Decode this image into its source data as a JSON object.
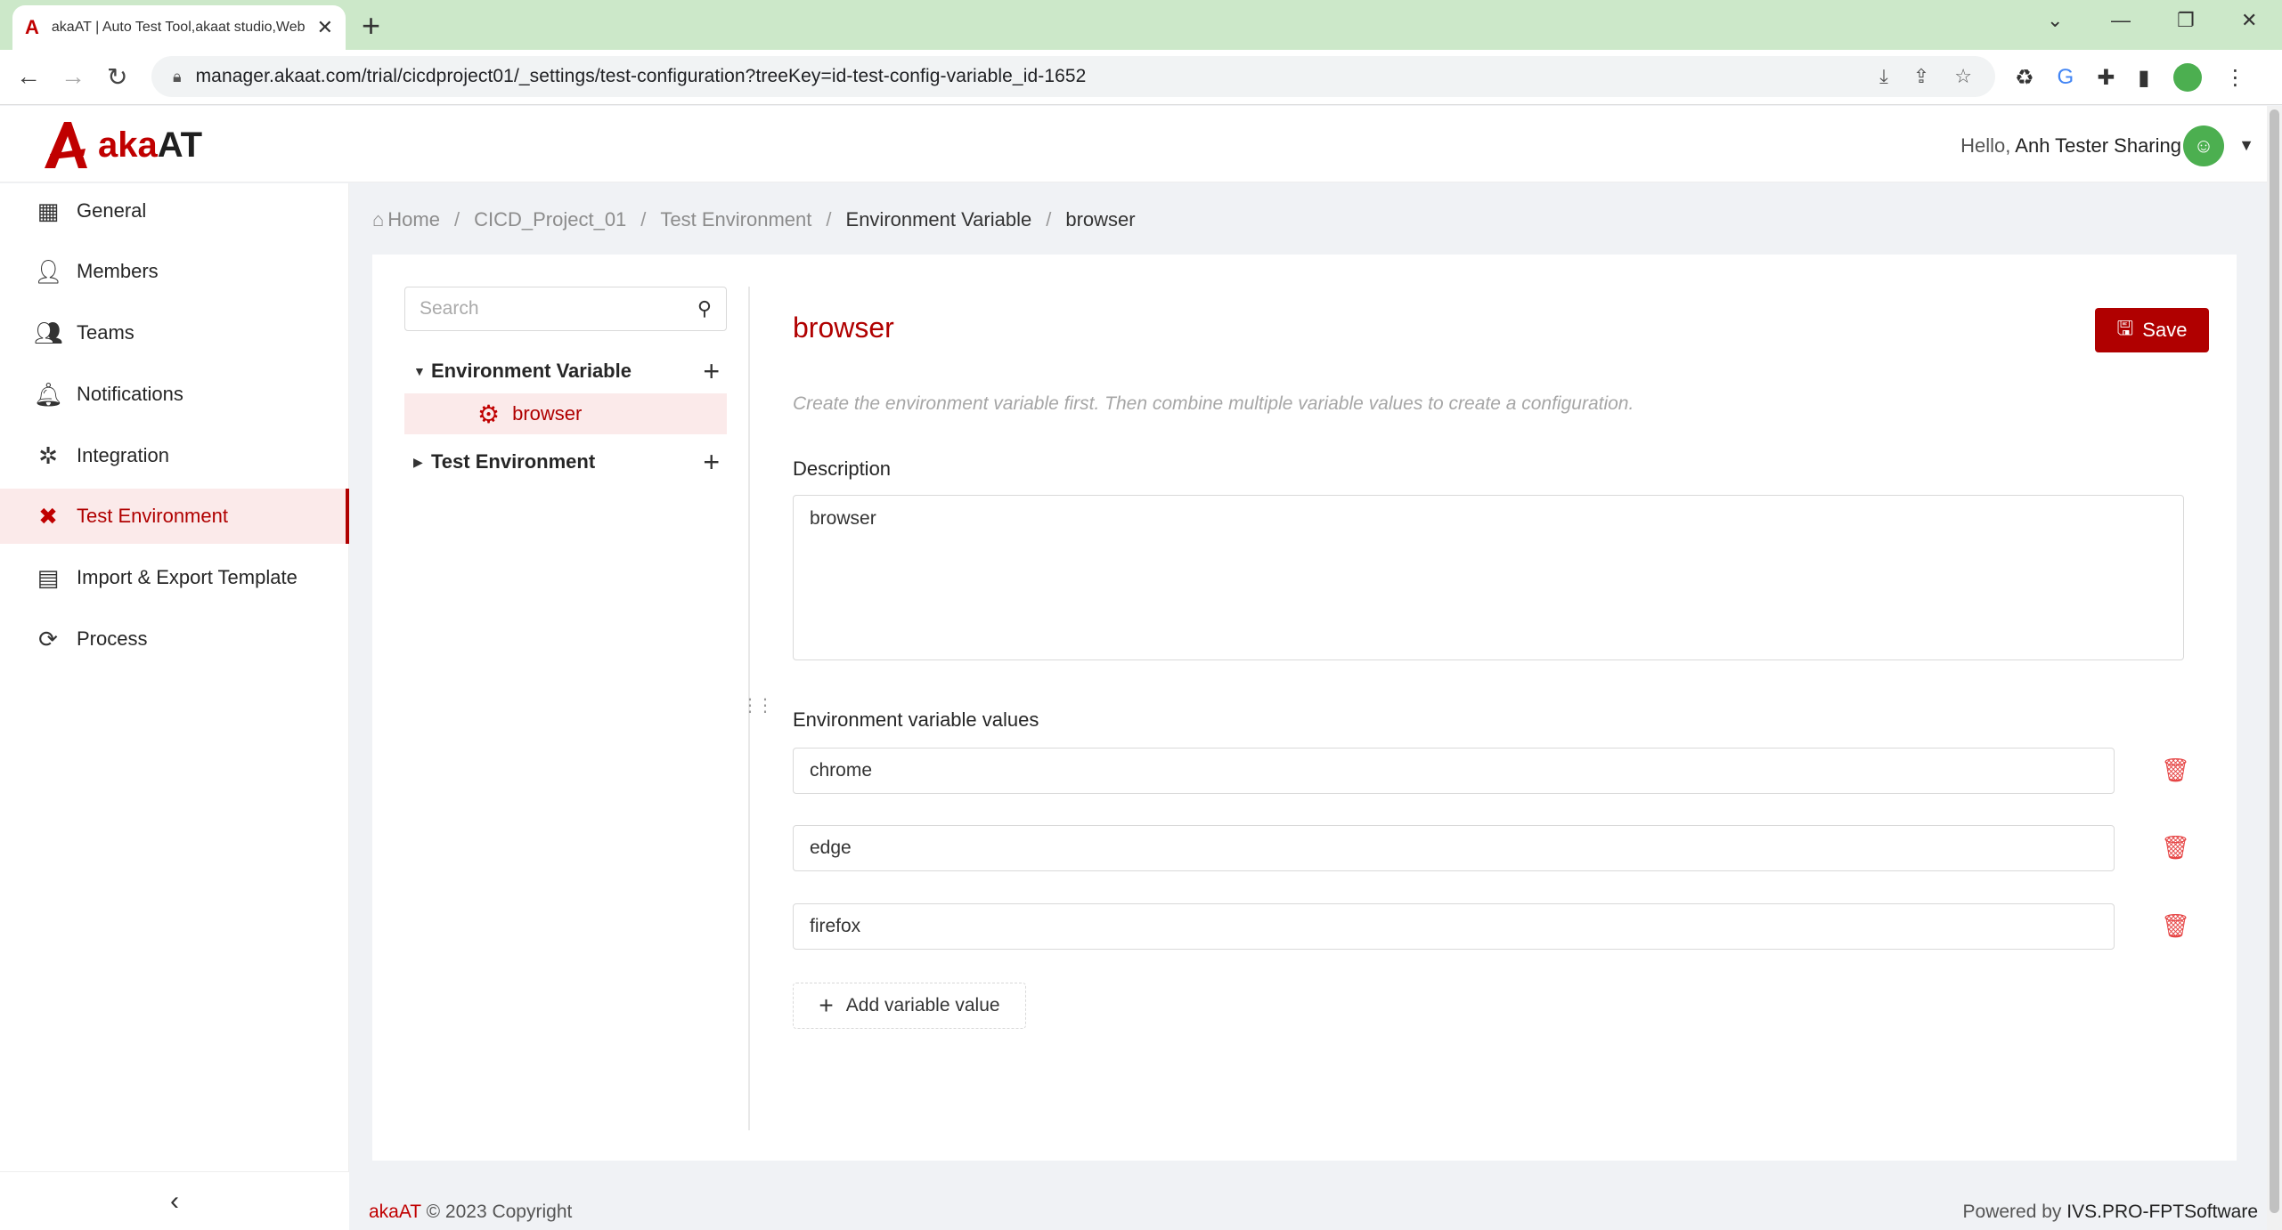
{
  "browser": {
    "tab_title": "akaAT | Auto Test Tool,akaat studio,Web",
    "url": "manager.akaat.com/trial/cicdproject01/_settings/test-configuration?treeKey=id-test-config-variable_id-1652"
  },
  "header": {
    "logo_aka": "aka",
    "logo_at": "AT",
    "hello": "Hello,",
    "user_name": "Anh Tester Sharing"
  },
  "sidebar": {
    "items": [
      {
        "label": "General",
        "icon": "grid-icon"
      },
      {
        "label": "Members",
        "icon": "members-icon"
      },
      {
        "label": "Teams",
        "icon": "teams-icon"
      },
      {
        "label": "Notifications",
        "icon": "bell-icon"
      },
      {
        "label": "Integration",
        "icon": "integration-icon"
      },
      {
        "label": "Test Environment",
        "icon": "tools-icon",
        "active": true
      },
      {
        "label": "Import & Export Template",
        "icon": "template-icon"
      },
      {
        "label": "Process",
        "icon": "process-icon"
      }
    ]
  },
  "breadcrumb": [
    "Home",
    "CICD_Project_01",
    "Test Environment",
    "Environment Variable",
    "browser"
  ],
  "tree": {
    "search_placeholder": "Search",
    "nodes": [
      {
        "label": "Environment Variable",
        "expanded": true,
        "children": [
          "browser"
        ]
      },
      {
        "label": "Test Environment",
        "expanded": false
      }
    ]
  },
  "detail": {
    "title": "browser",
    "save_label": "Save",
    "hint": "Create the environment variable first. Then combine multiple variable values to create a configuration.",
    "description_label": "Description",
    "description_value": "browser",
    "values_label": "Environment variable values",
    "values": [
      "chrome",
      "edge",
      "firefox"
    ],
    "add_label": "Add variable value"
  },
  "footer": {
    "brand": "akaAT",
    "copyright": " © 2023 Copyright",
    "powered_by": "Powered by",
    "company": "IVS.PRO-FPTSoftware"
  },
  "colors": {
    "accent": "#b00000",
    "active_bg": "#fbeaea",
    "tabstrip": "#cce8c9",
    "delete": "#e64545"
  }
}
